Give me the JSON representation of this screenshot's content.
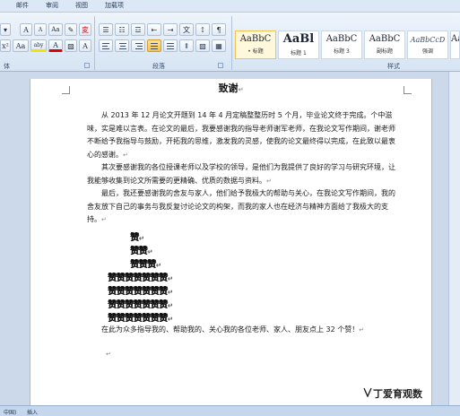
{
  "ribbon": {
    "tabs": [
      "邮件",
      "审阅",
      "视图",
      "加载项"
    ],
    "groups": {
      "font": "体",
      "paragraph": "段落",
      "styles": "样式"
    },
    "font_buttons": {
      "grow": "A",
      "shrink": "A",
      "case": "Aa",
      "highlight": "aby",
      "color": "A",
      "border": "A",
      "row2_first": "Aa"
    },
    "styles": [
      {
        "preview": "AaBbC",
        "name": "• 标题"
      },
      {
        "preview": "AaBl",
        "name": "标题 1"
      },
      {
        "preview": "AaBbC",
        "name": "标题 3"
      },
      {
        "preview": "AaBbC",
        "name": "副标题"
      },
      {
        "preview": "AaBbCcD",
        "name": "强调"
      },
      {
        "preview": "Aa",
        "name": ""
      }
    ]
  },
  "document": {
    "title": "致谢",
    "paragraphs": [
      "从 2013 年 12 月论文开题到 14 年 4 月定稿整整历时 5 个月，毕业论文终于完成。个中滋味，实是难以言表。在论文的最后，我要感谢我的指导老师谢军老师，在我论文写作期间，谢老师不断给予我指导与鼓励，开拓我的思维，激发我的灵感，使我的论文最终得以完成，在此致以最衷心的感谢。",
      "其次要感谢我的各位授课老师以及学校的领导，是他们为我提供了良好的学习与研究环境，让我能够收集到论文所需要的更精确、优质的数据与资料。",
      "最后，我还要感谢我的舍友与家人，他们给予我极大的帮助与关心，在我论文写作期间，我的舍友放下自己的事务与我反复讨论论文的构架，而我的家人也在经济与精神方面给了我极大的支持。"
    ],
    "pyramid": [
      "赞",
      "赞赞",
      "赞赞赞",
      "赞赞赞赞赞赞赞",
      "赞赞赞赞赞赞赞",
      "赞赞赞赞赞赞赞",
      "赞赞赞赞赞赞赞"
    ],
    "closing": "在此为众多指导我的、帮助我的、关心我的各位老师、家人、朋友点上 32 个赞！",
    "para_mark": "↵"
  },
  "status_bar": {
    "language": "中国)",
    "mode": "插入"
  },
  "watermark": "丁爱育观数"
}
